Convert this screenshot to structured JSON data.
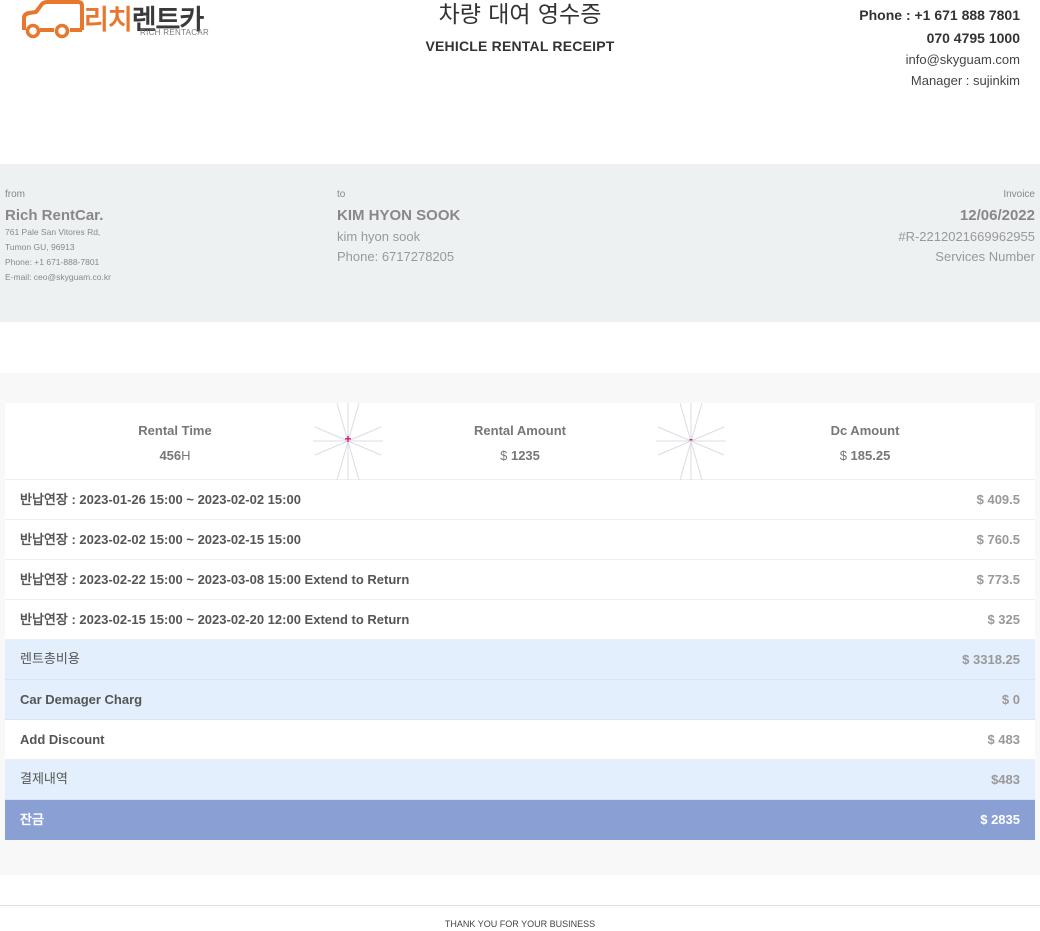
{
  "header": {
    "logo_ko_orange": "리치",
    "logo_ko_dark": "렌트카",
    "logo_en": "RICH RENTACAR",
    "title_ko": "차량 대여 영수증",
    "title_en": "VEHICLE RENTAL RECEIPT",
    "phone1": "Phone : +1 671 888 7801",
    "phone2": "070 4795 1000",
    "email": "info@skyguam.com",
    "manager": "Manager : sujinkim",
    "brand_color": "#e8772e"
  },
  "from": {
    "label": "from",
    "name": "Rich RentCar.",
    "address1": "761 Pale San Vitores Rd,",
    "address2": "Tumon GU, 96913",
    "phone": "Phone: +1 671-888-7801",
    "email": "E-mail: ceo@skyguam.co.kr"
  },
  "to": {
    "label": "to",
    "name": "KIM HYON SOOK",
    "name_lower": "kim hyon sook",
    "phone": "Phone: 6717278205"
  },
  "invoice": {
    "label": "Invoice",
    "date": "12/06/2022",
    "number": "#R-2212021669962955",
    "services": "Services Number"
  },
  "summary": {
    "rental_time_label": "Rental Time",
    "rental_time_value": "456",
    "rental_time_unit": "H",
    "plus_sign": "+",
    "rental_amount_label": "Rental Amount",
    "rental_amount_currency": "$",
    "rental_amount_value": "1235",
    "minus_sign": "-",
    "dc_amount_label": "Dc Amount",
    "dc_amount_currency": "$",
    "dc_amount_value": "185.25"
  },
  "extensions": [
    {
      "label": "반납연장 : 2023-01-26 15:00 ~ 2023-02-02 15:00",
      "amount": "$ 409.5"
    },
    {
      "label": "반납연장 : 2023-02-02 15:00 ~ 2023-02-15 15:00",
      "amount": "$ 760.5"
    },
    {
      "label": "반납연장 : 2023-02-22 15:00 ~ 2023-03-08 15:00 Extend to Return",
      "amount": "$ 773.5"
    },
    {
      "label": "반납연장 : 2023-02-15 15:00 ~ 2023-02-20 12:00 Extend to Return",
      "amount": "$ 325"
    }
  ],
  "totals": {
    "rent_total_label": "렌트총비용",
    "rent_total_amount": "$ 3318.25",
    "damage_label": "Car Demager Charg",
    "damage_amount": "$ 0",
    "discount_label": "Add Discount",
    "discount_amount": "$ 483",
    "payment_label": "결제내역",
    "payment_amount": "$483",
    "balance_label": "잔금",
    "balance_amount": "$ 2835",
    "row_highlight_color": "#e3effc",
    "balance_color": "#8a9fd4"
  },
  "footer": {
    "text": "THANK YOU FOR YOUR BUSINESS"
  }
}
